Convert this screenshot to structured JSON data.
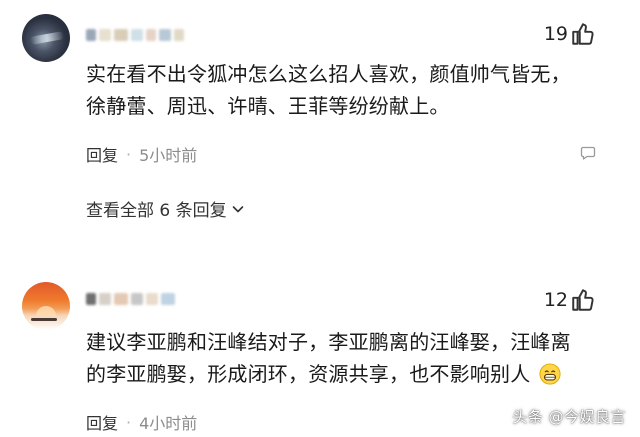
{
  "comments": [
    {
      "like_count": "19",
      "text_line1": "实在看不出令狐冲怎么这么招人喜欢，颜值帅气皆无，",
      "text_line2": "徐静蕾、周迅、许晴、王菲等纷纷献上。",
      "reply_label": "回复",
      "separator": "·",
      "time": "5小时前",
      "view_replies": "查看全部 6 条回复",
      "username_blur_colors": [
        "#9aa7b8",
        "#e7dfd0",
        "#d9cdb8",
        "#cfe0e8",
        "#e6d3c8",
        "#b8c8d6",
        "#e1d9c6"
      ]
    },
    {
      "like_count": "12",
      "text_line1": "建议李亚鹏和汪峰结对子，李亚鹏离的汪峰娶，汪峰离",
      "text_line2": "的李亚鹏娶，形成闭环，资源共享，也不影响别人",
      "reply_label": "回复",
      "separator": "·",
      "time": "4小时前",
      "username_blur_colors": [
        "#6f6f6f",
        "#d6d0c9",
        "#e4c9b4",
        "#c7c7c7",
        "#e9dccb",
        "#bfd3e3"
      ]
    }
  ],
  "watermark": "头条 @今娱良言",
  "colors": {
    "text": "#1a1a1a",
    "muted": "#8c8c8c",
    "background": "#ffffff"
  }
}
